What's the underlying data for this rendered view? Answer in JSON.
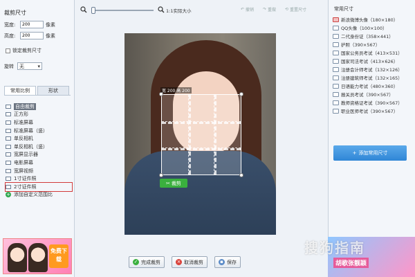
{
  "left": {
    "title": "裁剪尺寸",
    "width_label": "宽度:",
    "width_value": "200",
    "width_unit": "像素",
    "height_label": "高度:",
    "height_value": "200",
    "height_unit": "像素",
    "lock_label": "锁定裁剪尺寸",
    "rotate_label": "旋转",
    "rotate_value": "无",
    "tabs": [
      "常用比例",
      "形状"
    ],
    "items": [
      "自由裁剪",
      "正方形",
      "标准屏幕",
      "标准屏幕（竖）",
      "单反相机",
      "单反相机（竖）",
      "宽屏显示器",
      "电影屏幕",
      "宽屏视频",
      "1寸证件照",
      "2寸证件照",
      "添加自定义范围比"
    ],
    "ad_button": "免费下载"
  },
  "toolbar": {
    "zoom_label": "1:1实际大小",
    "zoom_fraction": 0.0,
    "undo": "撤销",
    "redo": "重做",
    "reset": "重置尺寸"
  },
  "crop": {
    "size_tag": "宽 200 高 200",
    "crop_button": "裁剪"
  },
  "bottom": {
    "done": "完成裁剪",
    "cancel": "取消裁剪",
    "save": "保存"
  },
  "right": {
    "title": "常用尺寸",
    "items": [
      "新浪微博头像（180×180）",
      "QQ头像（100×100）",
      "二代身份证（358×441）",
      "护照（390×567）",
      "国家公务员考试（413×531）",
      "国家司法考试（413×626）",
      "注册会计师考试（132×126）",
      "注册建筑师考试（132×165）",
      "日语能力考试（480×360）",
      "报关员考试（390×567）",
      "教师资格证考试（390×567）",
      "职业医师考试（390×567）"
    ],
    "add_button": "添加常用尺寸",
    "watermark": "搜狗指南",
    "ad_text": "胡歌张靓颖"
  },
  "colors": {
    "accent": "#2f86d6",
    "crop_green": "#3ab03e",
    "highlight_red": "#d23a3a"
  }
}
